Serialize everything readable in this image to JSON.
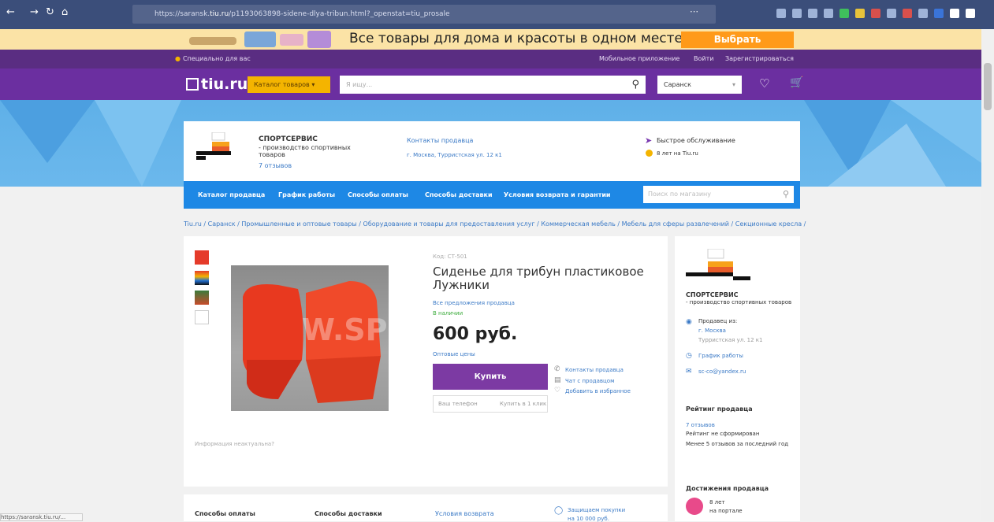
{
  "browser": {
    "url_prefix": "https://saransk.",
    "url_domain": "tiu.ru",
    "url_rest": "/p1193063898-sidene-dlya-tribun.html?_openstat=tiu_prosale"
  },
  "promo": {
    "text": "Все товары для дома и красоты в одном месте",
    "button": "Выбрать"
  },
  "topbar": {
    "special": "Специально для вас",
    "mobile_app": "Мобильное приложение",
    "login": "Войти",
    "register": "Зарегистрироваться"
  },
  "header": {
    "logo": "tiu.ru",
    "catalog": "Каталог товаров",
    "search_placeholder": "Я ищу...",
    "city": "Саранск"
  },
  "shop": {
    "name": "СПОРТСЕРВИС",
    "subtitle": "- производство спортивных товаров",
    "reviews": "7 отзывов",
    "contacts": "Контакты продавца",
    "address": "г. Москва, Турристская ул. 12 к1",
    "fast_service": "Быстрое обслуживание",
    "years": "8 лет на Tiu.ru",
    "nav": [
      "Каталог продавца",
      "График работы",
      "Способы оплаты",
      "Способы доставки",
      "Условия возврата и гарантии"
    ],
    "search_placeholder": "Поиск по магазину"
  },
  "breadcrumbs": "Tiu.ru / Саранск / Промышленные и оптовые товары / Оборудование и товары для предоставления услуг / Коммерческая мебель / Мебель для сферы развлечений / Секционные кресла / Сиде...",
  "product": {
    "code": "Код: СТ-501",
    "title_line1": "Сиденье для трибун пластиковое",
    "title_line2": "Лужники",
    "all_offers": "Все предложения продавца",
    "availability": "В наличии",
    "price": "600 руб.",
    "wholesale": "Оптовые цены",
    "buy": "Купить",
    "phone_placeholder": "Ваш телефон",
    "one_click": "Купить в 1 клик",
    "contacts": "Контакты продавца",
    "chat": "Чат с продавцом",
    "favorite": "Добавить в избранное",
    "info_question": "Информация неактуальна?",
    "watermark": "W.SPO"
  },
  "sidebar": {
    "shop_name": "СПОРТСЕРВИС",
    "shop_desc": "- производство спортивных товаров",
    "seller_from": "Продавец из:",
    "city": "г. Москва",
    "street": "Турристская ул. 12 к1",
    "schedule": "График работы",
    "email": "sc-co@yandex.ru",
    "rating_title": "Рейтинг продавца",
    "reviews": "7 отзывов",
    "rating_text": "Рейтинг не сформирован",
    "rating_sub": "Менее 5 отзывов за последний год",
    "achievements": "Достижения продавца",
    "years": "8 лет",
    "on_portal": "на портале"
  },
  "bottom": {
    "payment": "Способы оплаты",
    "delivery": "Способы доставки",
    "returns": "Условия возврата",
    "protected": "Защищаем покупки",
    "protected_sub": "на 10 000 руб."
  },
  "status_url": "https://saransk.tiu.ru/..."
}
